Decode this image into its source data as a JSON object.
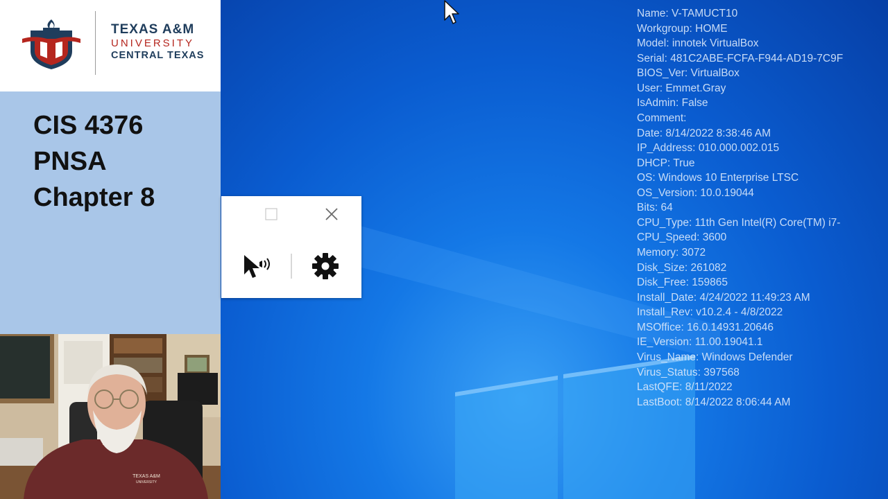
{
  "logo": {
    "line1": "TEXAS A&M",
    "line2": "UNIVERSITY",
    "line3": "CENTRAL TEXAS",
    "shirt_line1": "TEXAS A&M",
    "shirt_line2": "UNIVERSITY"
  },
  "course": {
    "line1": "CIS 4376",
    "line2": "PNSA",
    "line3": "Chapter 8"
  },
  "bginfo": [
    "Name: V-TAMUCT10",
    "Workgroup: HOME",
    "Model: innotek VirtualBox",
    "Serial: 481C2ABE-FCFA-F944-AD19-7C9F",
    "BIOS_Ver: VirtualBox",
    "User: Emmet.Gray",
    "IsAdmin: False",
    "Comment:",
    "Date: 8/14/2022 8:38:46 AM",
    "IP_Address: 010.000.002.015",
    "DHCP: True",
    "OS: Windows 10 Enterprise LTSC",
    "OS_Version: 10.0.19044",
    "Bits: 64",
    "CPU_Type: 11th Gen Intel(R) Core(TM) i7-",
    "CPU_Speed: 3600",
    "Memory: 3072",
    "Disk_Size: 261082",
    "Disk_Free: 159865",
    "Install_Date: 4/24/2022 11:49:23 AM",
    "Install_Rev: v10.2.4 - 4/8/2022",
    "MSOffice: 16.0.14931.20646",
    "IE_Version: 11.00.19041.1",
    "Virus_Name: Windows Defender",
    "Virus_Status: 397568",
    "LastQFE: 8/11/2022",
    "LastBoot: 8/14/2022 8:06:44 AM"
  ],
  "icons": {
    "maximize": "maximize-icon",
    "close": "close-icon",
    "cursor_tool": "cursor-sound-icon",
    "settings": "gear-icon"
  },
  "colors": {
    "slide_panel": "#a9c6e8",
    "logo_navy": "#1f3d5c",
    "logo_red": "#b5261e",
    "desktop_blue": "#0a5fd6",
    "bginfo_text": "#d7e6fa"
  }
}
